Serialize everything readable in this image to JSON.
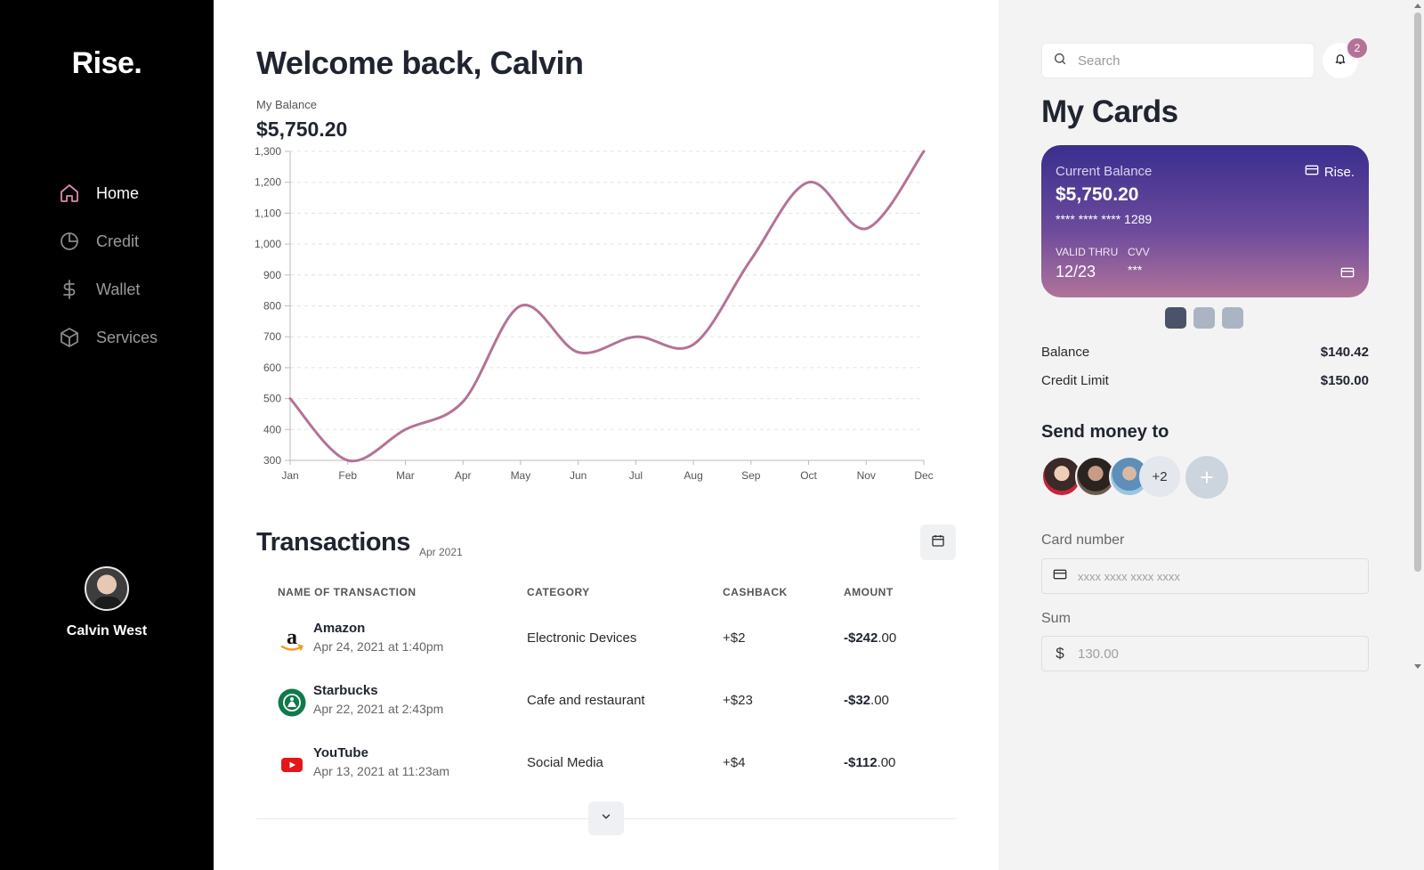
{
  "app": {
    "logo": "Rise."
  },
  "sidebar": {
    "items": [
      {
        "label": "Home",
        "icon": "home-icon",
        "active": true
      },
      {
        "label": "Credit",
        "icon": "pie-chart-icon",
        "active": false
      },
      {
        "label": "Wallet",
        "icon": "dollar-icon",
        "active": false
      },
      {
        "label": "Services",
        "icon": "box-icon",
        "active": false
      }
    ],
    "user": {
      "name": "Calvin West"
    }
  },
  "main": {
    "welcome_prefix": "Welcome back, ",
    "welcome_name": "Calvin",
    "balance_label": "My Balance",
    "balance_value": "$5,750.20"
  },
  "chart_data": {
    "type": "line",
    "categories": [
      "Jan",
      "Feb",
      "Mar",
      "Apr",
      "May",
      "Jun",
      "Jul",
      "Aug",
      "Sep",
      "Oct",
      "Nov",
      "Dec"
    ],
    "series": [
      {
        "values": [
          500,
          300,
          400,
          490,
          800,
          650,
          700,
          675,
          950,
          1200,
          1050,
          1300
        ]
      }
    ],
    "yticks": [
      300,
      400,
      500,
      600,
      700,
      800,
      900,
      1000,
      1100,
      1200,
      1300
    ],
    "ytick_labels": [
      "300",
      "400",
      "500",
      "600",
      "700",
      "800",
      "900",
      "1,000",
      "1,100",
      "1,200",
      "1,300"
    ],
    "ylim": [
      300,
      1300
    ],
    "grid": true,
    "color": "#b47296"
  },
  "transactions": {
    "title": "Transactions",
    "period": "Apr 2021",
    "headers": {
      "name": "NAME OF TRANSACTION",
      "category": "CATEGORY",
      "cashback": "CASHBACK",
      "amount": "AMOUNT"
    },
    "rows": [
      {
        "name": "Amazon",
        "date": "Apr 24, 2021 at 1:40pm",
        "category": "Electronic Devices",
        "cashback": "+$2",
        "amount_main": "-$242",
        "amount_cents": ".00",
        "logo": "amazon-logo"
      },
      {
        "name": "Starbucks",
        "date": "Apr 22, 2021 at 2:43pm",
        "category": "Cafe and restaurant",
        "cashback": "+$23",
        "amount_main": "-$32",
        "amount_cents": ".00",
        "logo": "starbucks-logo"
      },
      {
        "name": "YouTube",
        "date": "Apr 13, 2021 at 11:23am",
        "category": "Social Media",
        "cashback": "+$4",
        "amount_main": "-$112",
        "amount_cents": ".00",
        "logo": "youtube-logo"
      }
    ]
  },
  "right": {
    "search_placeholder": "Search",
    "notifications_count": "2",
    "cards_title": "My Cards",
    "card": {
      "balance_label": "Current Balance",
      "balance_value": "$5,750.20",
      "number": "**** **** **** 1289",
      "brand": "Rise.",
      "valid_label": "VALID THRU",
      "valid_value": "12/23",
      "cvv_label": "CVV",
      "cvv_value": "***"
    },
    "card_pager": {
      "count": 3,
      "active": 0
    },
    "balance_label": "Balance",
    "balance_value": "$140.42",
    "credit_label": "Credit Limit",
    "credit_value": "$150.00",
    "send_title": "Send money to",
    "more_people": "+2",
    "add_symbol": "+",
    "card_number_label": "Card number",
    "card_number_placeholder": "xxxx xxxx xxxx xxxx",
    "sum_label": "Sum",
    "sum_currency": "$",
    "sum_placeholder": "130.00"
  }
}
